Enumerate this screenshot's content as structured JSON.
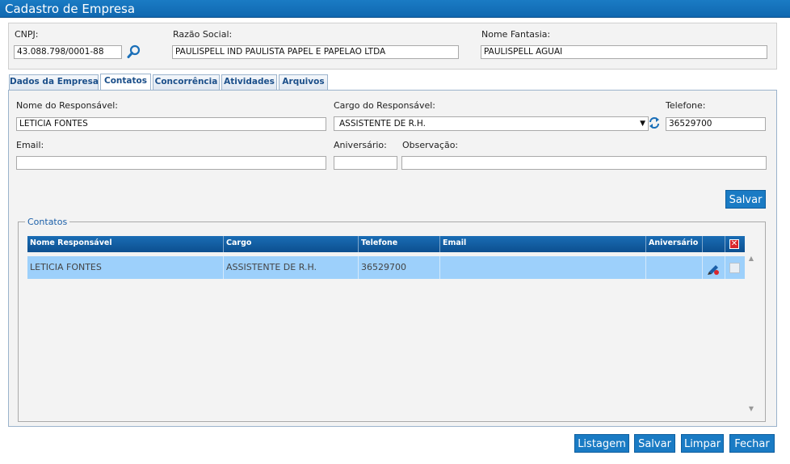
{
  "window": {
    "title": "Cadastro de Empresa"
  },
  "header": {
    "cnpj_label": "CNPJ:",
    "cnpj_value": "43.088.798/0001-88",
    "razao_label": "Razão Social:",
    "razao_value": "PAULISPELL IND PAULISTA PAPEL E PAPELAO LTDA",
    "fantasia_label": "Nome Fantasia:",
    "fantasia_value": "PAULISPELL AGUAI"
  },
  "tabs": [
    {
      "label": "Dados da Empresa",
      "active": false
    },
    {
      "label": "Contatos",
      "active": true
    },
    {
      "label": "Concorrência",
      "active": false
    },
    {
      "label": "Atividades",
      "active": false
    },
    {
      "label": "Arquivos",
      "active": false
    }
  ],
  "form": {
    "nome_label": "Nome do Responsável:",
    "nome_value": "LETICIA FONTES",
    "cargo_label": "Cargo do Responsável:",
    "cargo_value": "ASSISTENTE DE R.H.",
    "telefone_label": "Telefone:",
    "telefone_value": "36529700",
    "email_label": "Email:",
    "email_value": "",
    "aniversario_label": "Aniversário:",
    "aniversario_value": "",
    "observacao_label": "Observação:",
    "observacao_value": "",
    "save_label": "Salvar"
  },
  "contatos": {
    "legend": "Contatos",
    "columns": [
      "Nome Responsável",
      "Cargo",
      "Telefone",
      "Email",
      "Aniversário"
    ],
    "rows": [
      {
        "nome": "LETICIA FONTES",
        "cargo": "ASSISTENTE DE R.H.",
        "telefone": "36529700",
        "email": "",
        "aniversario": ""
      }
    ]
  },
  "footer": {
    "listagem_label": "Listagem",
    "salvar_label": "Salvar",
    "limpar_label": "Limpar",
    "fechar_label": "Fechar"
  },
  "colors": {
    "accent": "#1a7bc4",
    "row_highlight": "#9dd0fb",
    "grid_header": "#0c4f8f"
  },
  "icons": [
    "search-icon",
    "select-arrow-icon",
    "refresh-icon",
    "edit-icon",
    "delete-all-icon",
    "checkbox-icon"
  ]
}
